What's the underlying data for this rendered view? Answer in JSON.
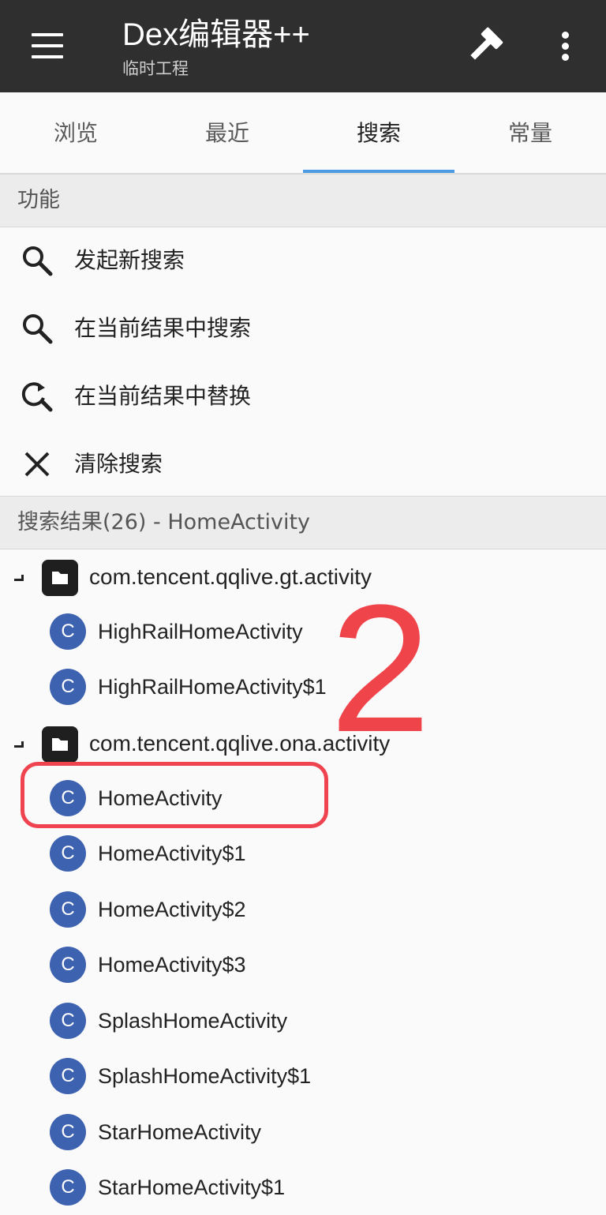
{
  "toolbar": {
    "title": "Dex编辑器++",
    "subtitle": "临时工程",
    "menu_icon": "menu-icon",
    "build_icon": "hammer-icon",
    "more_icon": "more-vert-icon"
  },
  "tabs": [
    {
      "label": "浏览"
    },
    {
      "label": "最近"
    },
    {
      "label": "搜索"
    },
    {
      "label": "常量"
    }
  ],
  "active_tab": "搜索",
  "functions": {
    "header": "功能",
    "items": [
      {
        "label": "发起新搜索",
        "icon": "search-icon"
      },
      {
        "label": "在当前结果中搜索",
        "icon": "search-icon"
      },
      {
        "label": "在当前结果中替换",
        "icon": "find-replace-icon"
      },
      {
        "label": "清除搜索",
        "icon": "close-icon"
      }
    ]
  },
  "results": {
    "header": "搜索结果(26) - HomeActivity",
    "groups": [
      {
        "package": "com.tencent.qqlive.gt.activity",
        "classes": [
          "HighRailHomeActivity",
          "HighRailHomeActivity$1"
        ]
      },
      {
        "package": "com.tencent.qqlive.ona.activity",
        "classes": [
          "HomeActivity",
          "HomeActivity$1",
          "HomeActivity$2",
          "HomeActivity$3",
          "SplashHomeActivity",
          "SplashHomeActivity$1",
          "StarHomeActivity",
          "StarHomeActivity$1"
        ]
      }
    ],
    "class_badge": "C"
  },
  "annotation": {
    "number": "2",
    "color": "#f0444b"
  },
  "colors": {
    "toolbar_bg": "#2f2f2f",
    "tab_indicator": "#4b9be3",
    "class_badge": "#3d62b0"
  }
}
